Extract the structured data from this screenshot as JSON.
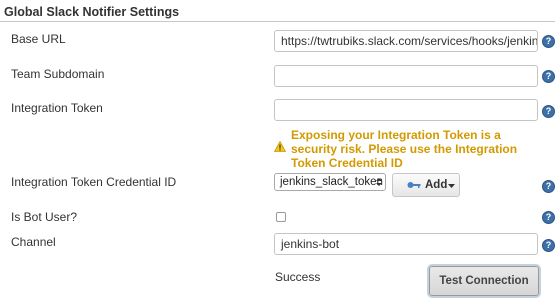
{
  "section": {
    "title": "Global Slack Notifier Settings"
  },
  "fields": {
    "base_url": {
      "label": "Base URL",
      "value": "https://twtrubiks.slack.com/services/hooks/jenkins-ci/"
    },
    "team_subdomain": {
      "label": "Team Subdomain",
      "value": ""
    },
    "integration_token": {
      "label": "Integration Token",
      "value": ""
    },
    "token_warning": "Exposing your Integration Token is a security risk. Please use the Integration Token Credential ID",
    "credential_id": {
      "label": "Integration Token Credential ID",
      "selected": "jenkins_slack_token",
      "add_label": "Add"
    },
    "bot_user": {
      "label": "Is Bot User?",
      "checked": false
    },
    "channel": {
      "label": "Channel",
      "value": "jenkins-bot"
    }
  },
  "connection": {
    "status": "Success",
    "button_label": "Test Connection"
  },
  "icons": {
    "help": "help-icon",
    "warning": "warning-icon",
    "key": "key-icon",
    "dropdown": "caret-down-icon"
  },
  "colors": {
    "warning": "#d29a00",
    "help": "#3d6fa8",
    "key": "#4a7fc1"
  }
}
